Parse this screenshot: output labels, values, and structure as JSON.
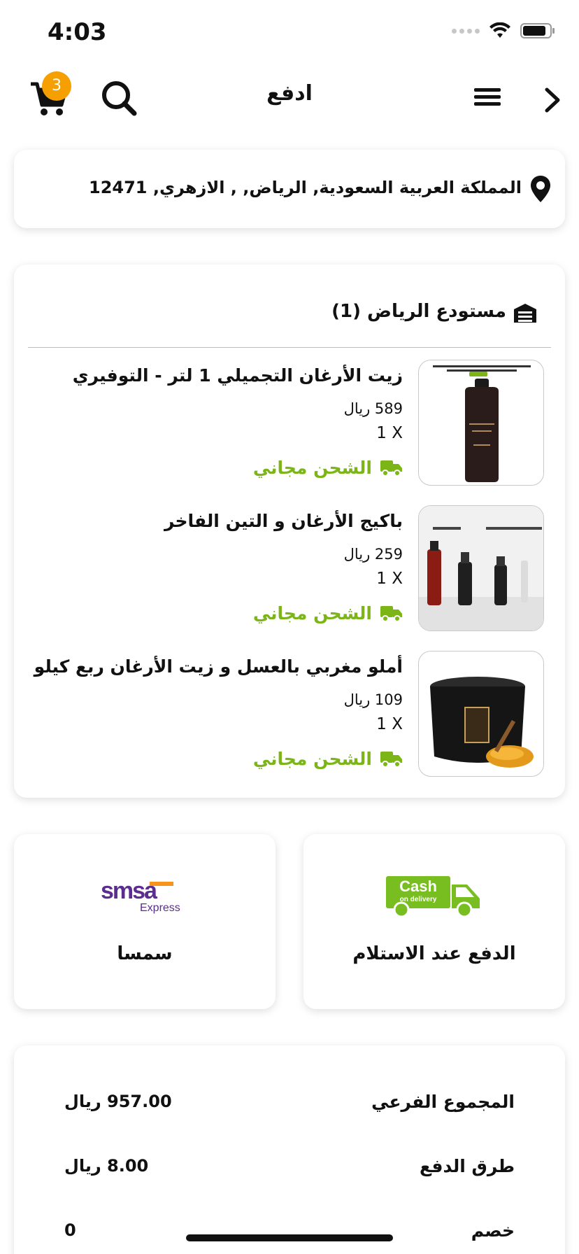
{
  "status_bar": {
    "time": "4:03"
  },
  "header": {
    "title": "ادفع",
    "cart_count": "3",
    "icons": [
      "cart-icon",
      "search-icon",
      "menu-icon",
      "chevron-right-icon"
    ]
  },
  "address": {
    "text": "المملكة العربية السعودية, الرياض, , الازهري, 12471",
    "icon": "location-pin-icon"
  },
  "warehouse": {
    "title": "مستودع الرياض (1)",
    "icon": "warehouse-icon",
    "items": [
      {
        "name": "زيت الأرغان التجميلي 1 لتر - التوفيري",
        "price": "589 ريال",
        "qty": "1 X",
        "shipping": "الشحن مجاني"
      },
      {
        "name": "باكيج الأرغان و التين الفاخر",
        "price": "259 ريال",
        "qty": "1 X",
        "shipping": "الشحن مجاني"
      },
      {
        "name": "أملو مغربي بالعسل  و زيت الأرغان ربع كيلو",
        "price": "109 ريال",
        "qty": "1 X",
        "shipping": "الشحن مجاني"
      }
    ]
  },
  "payment": {
    "cod": {
      "label": "الدفع عند الاستلام",
      "logo_line1": "Cash",
      "logo_line2": "on delivery"
    },
    "smsa": {
      "label": "سمسا",
      "logo_main": "smsa",
      "logo_sub": "Express"
    }
  },
  "summary": {
    "subtotal_label": "المجموع الفرعي",
    "subtotal_value": "957.00 ريال",
    "payment_label": "طرق الدفع",
    "payment_value": "8.00 ريال",
    "discount_label": "خصم",
    "discount_value": "0"
  },
  "colors": {
    "accent_green": "#7cb518",
    "badge_orange": "#f5a000",
    "smsa_purple": "#5b2d90",
    "smsa_orange": "#f7941d"
  }
}
